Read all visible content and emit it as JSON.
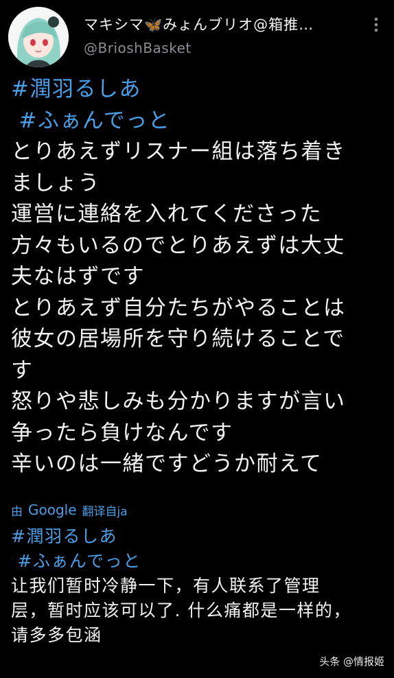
{
  "header": {
    "display_name": "マキシマ🦋みょんブリオ@箱推…",
    "handle": "@BrioshBasket",
    "avatar_icon": "anime-girl-avatar",
    "more_icon": "more-vert-icon"
  },
  "tweet": {
    "hashtag1": "#潤羽るしあ",
    "hashtag2": " #ふぁんでっと",
    "lines": [
      "とりあえずリスナー組は落ち着き",
      "ましょう",
      "運営に連絡を入れてくださった",
      "方々もいるのでとりあえずは大丈",
      "夫なはずです",
      "とりあえず自分たちがやることは",
      "彼女の居場所を守り続けることで",
      "す",
      "怒りや悲しみも分かりますが言い",
      "争ったら負けなんです",
      "辛いのは一緒ですどうか耐えて"
    ]
  },
  "translation": {
    "by": "由",
    "provider": "Google",
    "translated_from": "翻译自ja",
    "hashtag1": "#潤羽るしあ",
    "hashtag2": " #ふぁんでっと",
    "lines": [
      "让我们暂时冷静一下，有人联系了管理",
      "层，暂时应该可以了. 什么痛都是一样的，",
      "请多多包涵"
    ]
  },
  "watermark": "头条 @情报姬",
  "colors": {
    "background": "#000000",
    "link": "#4a9fe8",
    "text": "#f2f2f2",
    "muted": "#8b8f94"
  }
}
